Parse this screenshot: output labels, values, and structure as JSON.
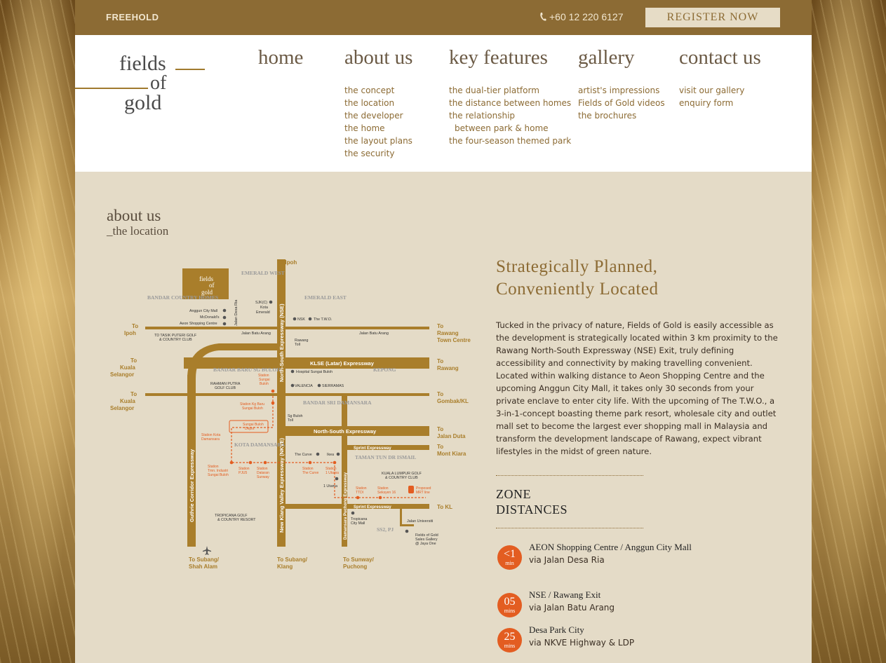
{
  "topbar": {
    "freehold": "FREEHOLD",
    "phone": "+60 12 220 6127",
    "register": "REGISTER NOW"
  },
  "logo": {
    "line1": "fields",
    "line2": "of",
    "line3": "gold"
  },
  "nav": [
    {
      "title": "home",
      "items": []
    },
    {
      "title": "about us",
      "items": [
        "the concept",
        "the location",
        "the developer",
        "the home",
        "the layout plans",
        "the security"
      ]
    },
    {
      "title": "key features",
      "items": [
        "the dual-tier platform",
        "the distance between homes",
        "the relationship",
        "between park & home",
        "the four-season themed park"
      ]
    },
    {
      "title": "gallery",
      "items": [
        "artist's impressions",
        "Fields of Gold videos",
        "the brochures"
      ]
    },
    {
      "title": "contact us",
      "items": [
        "visit our gallery",
        "enquiry form"
      ]
    }
  ],
  "breadcrumb": {
    "section": "about us",
    "page": "_the location"
  },
  "heading": {
    "line1": "Strategically Planned,",
    "line2": "Conveniently Located"
  },
  "paragraph": "Tucked in the privacy of nature, Fields of Gold is easily accessible as the development is strategically located within 3 km proximity to the Rawang North-South Expressway (NSE) Exit, truly defining accessibility and connectivity by making travelling convenient. Located within walking distance to Aeon Shopping Centre and the upcoming Anggun City Mall, it takes only 30 seconds from your private enclave to enter city life. With the upcoming of The T.W.O., a 3-in-1-concept boasting theme park resort, wholesale city and outlet mall set to become the largest ever shopping mall in Malaysia and transform the development landscape of Rawang, expect vibrant lifestyles in the midst of green nature.",
  "zone": {
    "title_line1": "ZONE",
    "title_line2": "DISTANCES",
    "items": [
      {
        "num": "<1",
        "unit": "min",
        "place": "AEON Shopping Centre / Anggun City Mall",
        "via": "via Jalan Desa Ria"
      },
      {
        "num": "05",
        "unit": "mins",
        "place": "NSE / Rawang Exit",
        "via": "via Jalan Batu Arang"
      },
      {
        "num": "25",
        "unit": "mins",
        "place": "Desa Park City",
        "via": "via NKVE Highway & LDP"
      }
    ]
  },
  "map": {
    "logo": [
      "fields",
      "of",
      "gold"
    ],
    "areas": [
      "EMERALD WEST",
      "EMERALD EAST",
      "BANDAR COUNTRY HOMES",
      "BANDAR BARU SG BULOH",
      "KEPONG",
      "BANDAR SRI DAMANSARA",
      "KOTA DAMANSARA",
      "TAMAN TUN DR ISMAIL",
      "SS2, PJ"
    ],
    "destinations": {
      "ipoh_top": "To Ipoh",
      "ipoh_left": [
        "To",
        "Ipoh"
      ],
      "kl_selangor_1": [
        "To",
        "Kuala",
        "Selangor"
      ],
      "kl_selangor_2": [
        "To",
        "Kuala",
        "Selangor"
      ],
      "rawang_tc": [
        "To",
        "Rawang",
        "Town Centre"
      ],
      "rawang": [
        "To",
        "Rawang"
      ],
      "gombak": [
        "To",
        "Gombak/KL"
      ],
      "jalan_duta": [
        "To",
        "Jalan Duta"
      ],
      "mont_kiara": [
        "To",
        "Mont Kiara"
      ],
      "to_kl": "To KL",
      "subang_shah": [
        "To Subang/",
        "Shah Alam"
      ],
      "subang_klang": [
        "To Subang/",
        "Klang"
      ],
      "sunway_puchong": [
        "To Sunway/",
        "Puchong"
      ]
    },
    "roads": {
      "klse": "KLSE (Latar) Expressway",
      "nse_h": "North-South Expressway",
      "sprint1": "Sprint Expressway",
      "sprint2": "Sprint Expressway",
      "nse_v": "North-South Expressway (NSE)",
      "nkve": "New Klang Valley Expressway (NKVE)",
      "guthrie": "Guthrie Corridor Expressway",
      "ldp": "Damansara Puchong Expressway",
      "batu_arang1": "Jalan Batu Arang",
      "batu_arang2": "Jalan Batu Arang",
      "desa_ria": "Jalan Desa Ria",
      "universiti": "Jalan Universiti"
    },
    "pois": {
      "anggun": "Anggun City Mall",
      "mcd": "McDonald's",
      "aeon": "Aeon Shopping Centre",
      "sjkc": [
        "SJK(C)",
        "Kota",
        "Emerald"
      ],
      "nsk": "NSK",
      "two": "The T.W.O.",
      "rawang_toll": [
        "Rawang",
        "Toll"
      ],
      "tasik_puteri": [
        "TD TASIK PUTERI GOLF",
        "& COUNTRY CLUB"
      ],
      "hospital": "Hospital Sungai Buloh",
      "valencia": "VALENCIA",
      "sierramas": "SIERRAMAS",
      "rahman_putra": [
        "RAHMAN PUTRA",
        "GOLF CLUB"
      ],
      "stn_sg_buloh": [
        "Station",
        "Sungai",
        "Buloh"
      ],
      "stn_kg_baru": [
        "Station Kg Baru",
        "Sungai Buloh"
      ],
      "sg_buloh_depot": [
        "Sungai Buloh",
        "Depot"
      ],
      "sg_buloh_toll": [
        "Sg Buloh",
        "Toll"
      ],
      "stn_kota_damansara": [
        "Station Kota",
        "Damansara"
      ],
      "stn_industri": [
        "Station",
        "Tmn. Industri",
        "Sungai Buloh"
      ],
      "stn_pjus": [
        "Station",
        "PJU5"
      ],
      "stn_dataran": [
        "Station",
        "Dataran",
        "Sunway"
      ],
      "the_curve_poi": "The Curve",
      "ikea": "Ikea",
      "stn_the_curve": [
        "Station",
        "The Curve"
      ],
      "stn_1utama": [
        "Station",
        "1 Utama"
      ],
      "one_utama": "1 Utama",
      "klgcc": [
        "KUALA LUMPUR GOLF",
        "& COUNTRY CLUB"
      ],
      "stn_ttdi": [
        "Station",
        "TTDI"
      ],
      "stn_seksyen16": [
        "Station",
        "Seksyen 16"
      ],
      "mrt": [
        "Proposed",
        "MRT line"
      ],
      "tropicana": [
        "TROPICANA GOLF",
        "& COUNTRY RESORT"
      ],
      "tropicana_mall": [
        "Tropicana",
        "City Mall"
      ],
      "sales_gallery": [
        "Fields of Gold",
        "Sales Gallery",
        "@ Jaya One"
      ]
    }
  }
}
